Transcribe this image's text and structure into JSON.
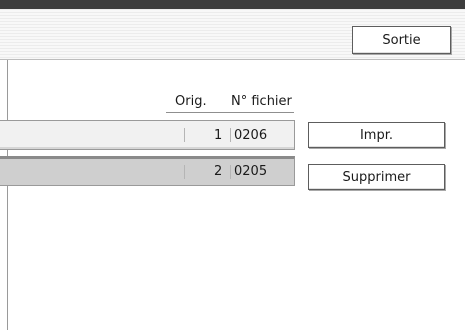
{
  "header": {
    "exit_label": "Sortie"
  },
  "table": {
    "columns": {
      "orig": "Orig.",
      "file_no": "N° fichier"
    },
    "rows": [
      {
        "orig": "1",
        "file_no": "0206"
      },
      {
        "orig": "2",
        "file_no": "0205"
      }
    ]
  },
  "actions": {
    "print_label": "Impr.",
    "delete_label": "Supprimer"
  }
}
